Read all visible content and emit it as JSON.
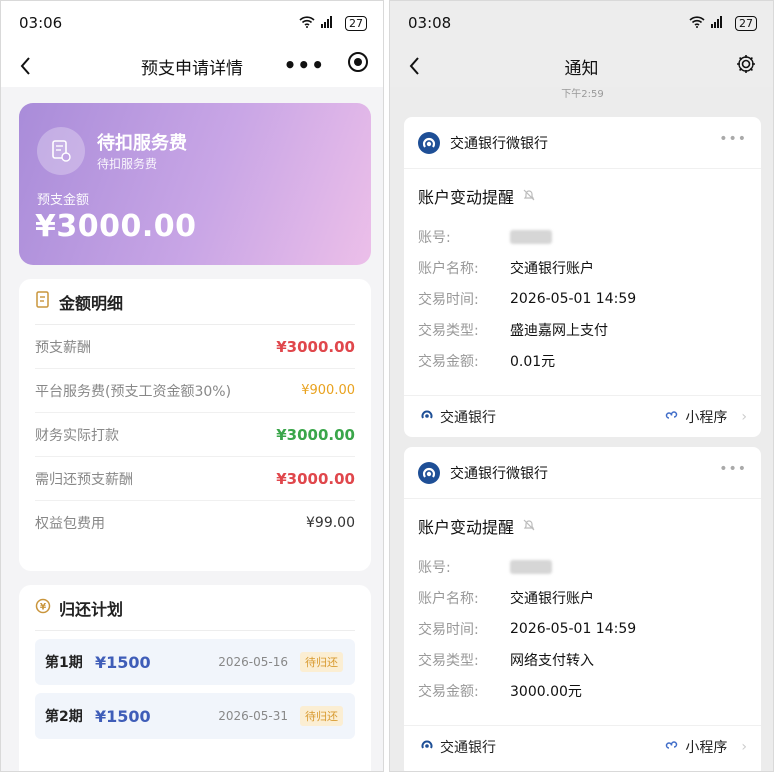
{
  "colors": {
    "red": "#e0474c",
    "orange": "#e9a21f",
    "green": "#3aa64a",
    "blue": "#3f5db8",
    "bank_blue": "#1e4f96",
    "hero_start": "#a98cd9",
    "hero_end": "#ecbfe9"
  },
  "left": {
    "status": {
      "time": "03:06",
      "battery": "27"
    },
    "nav": {
      "title": "预支申请详情",
      "more_icon": "more-dots-icon",
      "close_icon": "target-close-icon"
    },
    "hero": {
      "title": "待扣服务费",
      "subtitle": "待扣服务费",
      "amount_label": "预支金额",
      "amount": "¥3000.00",
      "icon": "receipt-icon"
    },
    "detail": {
      "title": "金额明细",
      "rows": [
        {
          "label": "预支薪酬",
          "value": "¥3000.00",
          "color": "#e0474c"
        },
        {
          "label": "平台服务费(预支工资金额30%)",
          "value": "¥900.00",
          "color": "#e9a21f"
        },
        {
          "label": "财务实际打款",
          "value": "¥3000.00",
          "color": "#3aa64a"
        },
        {
          "label": "需归还预支薪酬",
          "value": "¥3000.00",
          "color": "#e0474c"
        },
        {
          "label": "权益包费用",
          "value": "¥99.00",
          "color": "#333333"
        }
      ]
    },
    "plan": {
      "title": "归还计划",
      "items": [
        {
          "period": "第1期",
          "amount": "¥1500",
          "date": "2026-05-16",
          "status": "待归还"
        },
        {
          "period": "第2期",
          "amount": "¥1500",
          "date": "2026-05-31",
          "status": "待归还"
        }
      ]
    }
  },
  "right": {
    "status": {
      "time": "03:08",
      "battery": "27"
    },
    "nav": {
      "title": "通知",
      "settings_icon": "gear-icon"
    },
    "timestamp": "下午2:59",
    "cards": [
      {
        "bank": "交通银行微银行",
        "title": "账户变动提醒",
        "fields": [
          {
            "key": "账号:",
            "value": ""
          },
          {
            "key": "账户名称:",
            "value": "交通银行账户"
          },
          {
            "key": "交易时间:",
            "value": "2026-05-01 14:59"
          },
          {
            "key": "交易类型:",
            "value": "盛迪嘉网上支付"
          },
          {
            "key": "交易金额:",
            "value": "0.01元"
          }
        ],
        "footer_left": "交通银行",
        "footer_right": "小程序"
      },
      {
        "bank": "交通银行微银行",
        "title": "账户变动提醒",
        "fields": [
          {
            "key": "账号:",
            "value": ""
          },
          {
            "key": "账户名称:",
            "value": "交通银行账户"
          },
          {
            "key": "交易时间:",
            "value": "2026-05-01 14:59"
          },
          {
            "key": "交易类型:",
            "value": "网络支付转入"
          },
          {
            "key": "交易金额:",
            "value": "3000.00元"
          }
        ],
        "footer_left": "交通银行",
        "footer_right": "小程序"
      }
    ]
  }
}
